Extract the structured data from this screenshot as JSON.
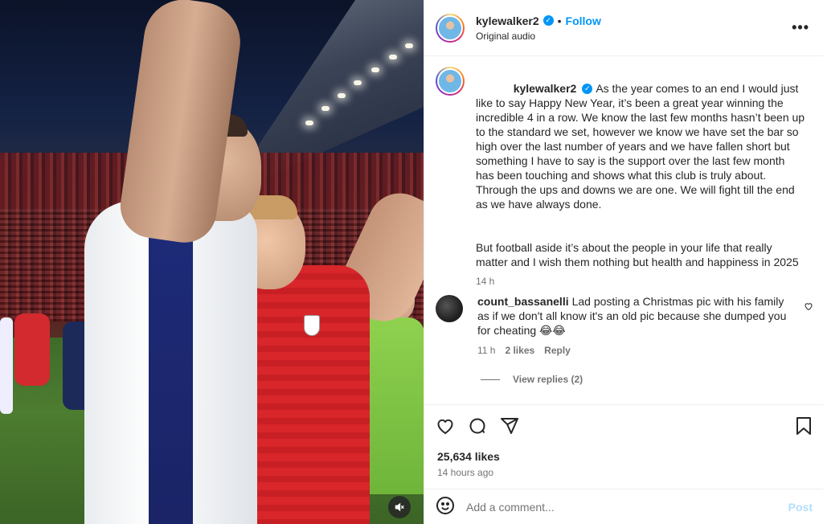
{
  "post": {
    "username": "kylewalker2",
    "follow_label": "Follow",
    "dot": "•",
    "audio": "Original audio",
    "more_label": "•••"
  },
  "caption": {
    "username": "kylewalker2",
    "para1": "As the year comes to an end I would just like to say Happy New Year, it’s been a great year winning the incredible 4 in a row. We know the last few months hasn’t been up to the standard we set, however we know we have set the bar so high over the last number of years and we have fallen short but something I have to say is the support over the last few month has been touching and shows what this club is truly about. Through the ups and downs we are one. We will fight till the end as we have always done.",
    "para2": "But football aside it’s about the people in your life that really matter and I wish them nothing but health and happiness in 2025",
    "time": "14 h"
  },
  "comment": {
    "username": "count_bassanelli",
    "text": "Lad posting a Christmas pic with his family as if we don't all know it's an old pic because she dumped you for cheating 😂😂",
    "time": "11 h",
    "likes": "2 likes",
    "reply_label": "Reply",
    "view_replies": "View replies (2)"
  },
  "stats": {
    "likes": "25,634 likes",
    "ago": "14 hours ago"
  },
  "composer": {
    "placeholder": "Add a comment...",
    "post_label": "Post"
  },
  "icons": {
    "verified": "verified-badge-icon",
    "like": "heart-icon",
    "comment": "comment-bubble-icon",
    "share": "paper-plane-icon",
    "save": "bookmark-icon",
    "emoji": "smiley-icon",
    "mute": "speaker-muted-icon"
  },
  "colors": {
    "accent": "#0095f6",
    "post_disabled": "#b2dffc",
    "muted_text": "#737373"
  }
}
